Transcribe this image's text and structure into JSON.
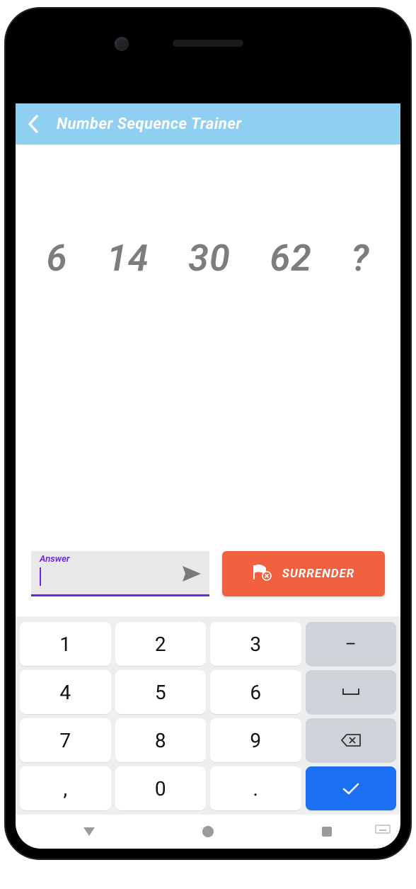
{
  "header": {
    "title": "Number Sequence Trainer"
  },
  "question": {
    "sequence": "6  14  30  62  ?"
  },
  "answer": {
    "label": "Answer",
    "value": ""
  },
  "surrender": {
    "label": "SURRENDER"
  },
  "keyboard": {
    "keys": {
      "k1": "1",
      "k2": "2",
      "k3": "3",
      "k4": "4",
      "k5": "5",
      "k6": "6",
      "k7": "7",
      "k8": "8",
      "k9": "9",
      "k0": "0",
      "comma": ",",
      "dot": ".",
      "minus": "–",
      "space": "␣"
    }
  }
}
